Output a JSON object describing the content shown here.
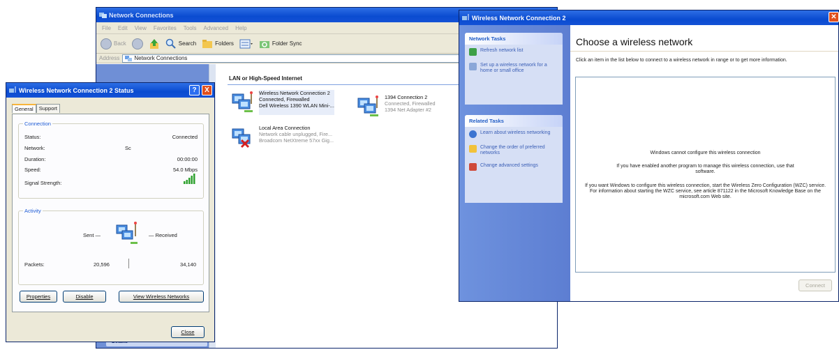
{
  "explorer": {
    "title": "Network Connections",
    "menu": [
      "File",
      "Edit",
      "View",
      "Favorites",
      "Tools",
      "Advanced",
      "Help"
    ],
    "toolbar": {
      "back": "Back",
      "search": "Search",
      "folders": "Folders",
      "folder_sync": "Folder Sync"
    },
    "address_label": "Address",
    "address_value": "Network Connections",
    "section": "LAN or High-Speed Internet",
    "connections": [
      {
        "name": "Wireless Network Connection 2",
        "status": "Connected, Firewalled",
        "device": "Dell Wireless 1390 WLAN Mini-..."
      },
      {
        "name": "1394 Connection 2",
        "status": "Connected, Firewalled",
        "device": "1394 Net Adapter #2"
      },
      {
        "name": "Local Area Connection",
        "status": "Network cable unplugged, Fire...",
        "device": "Broadcom NetXtreme 57xx Gig..."
      }
    ],
    "details_label": "Details"
  },
  "status_dialog": {
    "title": "Wireless Network Connection 2 Status",
    "help_btn": "?",
    "close_btn": "X",
    "tabs": [
      "General",
      "Support"
    ],
    "connection_group": "Connection",
    "status_label": "Status:",
    "status_value": "Connected",
    "network_label": "Network:",
    "network_value": "Sc",
    "duration_label": "Duration:",
    "duration_value": "00:00:00",
    "speed_label": "Speed:",
    "speed_value": "54.0 Mbps",
    "signal_label": "Signal Strength:",
    "activity_group": "Activity",
    "sent_label": "Sent —",
    "received_label": "— Received",
    "packets_label": "Packets:",
    "packets_sent": "20,596",
    "packets_received": "34,140",
    "properties_btn": "Properties",
    "disable_btn": "Disable",
    "view_wireless_btn": "View Wireless Networks",
    "close_label": "Close"
  },
  "wireless_window": {
    "title": "Wireless Network Connection 2",
    "network_tasks": "Network Tasks",
    "refresh": "Refresh network list",
    "setup": "Set up a wireless network for a home or small office",
    "related_tasks": "Related Tasks",
    "learn": "Learn about wireless networking",
    "change_order": "Change the order of preferred networks",
    "change_advanced": "Change advanced settings",
    "heading": "Choose a wireless network",
    "instruction": "Click an item in the list below to connect to a wireless network in range or to get more information.",
    "msg1": "Windows cannot configure this wireless connection",
    "msg2": "If you have enabled another program to manage this wireless connection, use that software.",
    "msg3": "If you want Windows to configure this wireless connection, start the Wireless Zero Configuration (WZC) service. For information about starting the WZC service, see article 871122 in the Microsoft Knowledge Base on the microsoft.com Web site.",
    "connect_btn": "Connect"
  }
}
